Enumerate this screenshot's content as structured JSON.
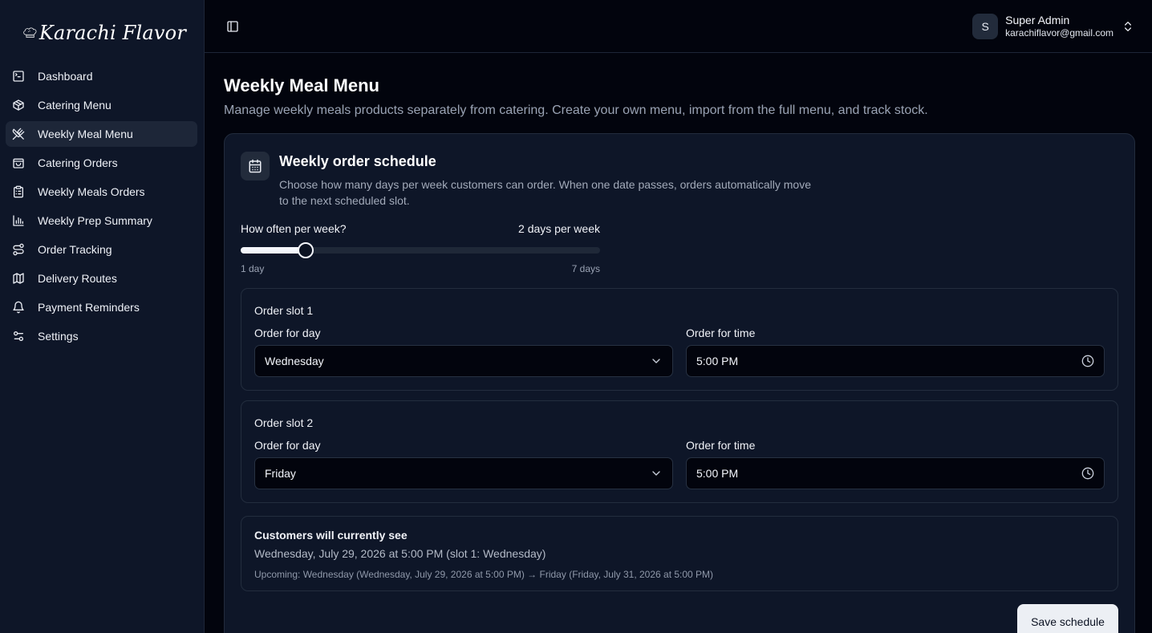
{
  "brand": {
    "name": "Karachi Flavor"
  },
  "sidebar": {
    "items": [
      {
        "label": "Dashboard",
        "icon": "terminal-square-icon",
        "active": false
      },
      {
        "label": "Catering Menu",
        "icon": "package-icon",
        "active": false
      },
      {
        "label": "Weekly Meal Menu",
        "icon": "utensils-crossed-icon",
        "active": true
      },
      {
        "label": "Catering Orders",
        "icon": "shopping-bag-icon",
        "active": false
      },
      {
        "label": "Weekly Meals Orders",
        "icon": "clipboard-list-icon",
        "active": false
      },
      {
        "label": "Weekly Prep Summary",
        "icon": "bar-chart-icon",
        "active": false
      },
      {
        "label": "Order Tracking",
        "icon": "route-icon",
        "active": false
      },
      {
        "label": "Delivery Routes",
        "icon": "map-icon",
        "active": false
      },
      {
        "label": "Payment Reminders",
        "icon": "bell-icon",
        "active": false
      },
      {
        "label": "Settings",
        "icon": "sliders-icon",
        "active": false
      }
    ]
  },
  "header": {
    "user": {
      "initial": "S",
      "name": "Super Admin",
      "email": "karachiflavor@gmail.com"
    }
  },
  "page": {
    "title": "Weekly Meal Menu",
    "subtitle": "Manage weekly meals products separately from catering. Create your own menu, import from the full menu, and track stock."
  },
  "schedule": {
    "title": "Weekly order schedule",
    "description": "Choose how many days per week customers can order. When one date passes, orders automatically move to the next scheduled slot.",
    "frequency_label": "How often per week?",
    "frequency_value_text": "2 days per week",
    "frequency": {
      "value": 2,
      "min": 1,
      "max": 7
    },
    "min_label": "1 day",
    "max_label": "7 days",
    "slots": [
      {
        "title": "Order slot 1",
        "day_label": "Order for day",
        "day": "Wednesday",
        "time_label": "Order for time",
        "time": "5:00 PM"
      },
      {
        "title": "Order slot 2",
        "day_label": "Order for day",
        "day": "Friday",
        "time_label": "Order for time",
        "time": "5:00 PM"
      }
    ],
    "preview": {
      "title": "Customers will currently see",
      "main": "Wednesday, July 29, 2026 at 5:00 PM (slot 1: Wednesday)",
      "upcoming": "Upcoming: Wednesday (Wednesday, July 29, 2026 at 5:00 PM) → Friday (Friday, July 31, 2026 at 5:00 PM)"
    },
    "save_label": "Save schedule"
  },
  "colors": {
    "background": "#02040d",
    "sidebar": "#0e1628",
    "card": "#0e1628",
    "accent": "#f4f6fb"
  }
}
